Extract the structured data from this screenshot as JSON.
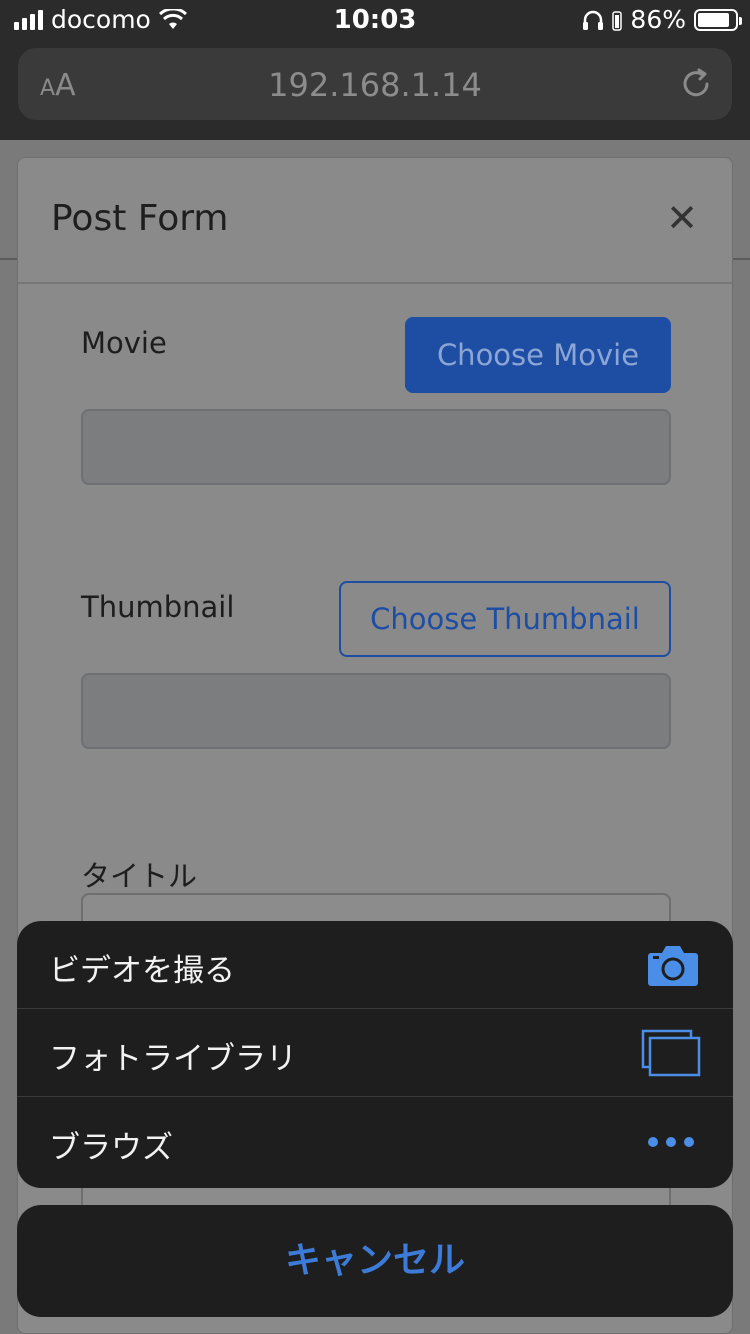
{
  "status_bar": {
    "carrier": "docomo",
    "time": "10:03",
    "battery": "86%",
    "battery_level": 0.86
  },
  "browser": {
    "text_size_label": "AA",
    "url": "192.168.1.14"
  },
  "modal": {
    "title": "Post Form",
    "close_symbol": "✕",
    "movie_label": "Movie",
    "choose_movie_label": "Choose Movie",
    "thumbnail_label": "Thumbnail",
    "choose_thumbnail_label": "Choose Thumbnail",
    "title_label": "タイトル"
  },
  "action_sheet": {
    "items": [
      {
        "label": "ビデオを撮る",
        "icon": "camera-icon"
      },
      {
        "label": "フォトライブラリ",
        "icon": "photo-library-icon"
      },
      {
        "label": "ブラウズ",
        "icon": "more-icon"
      }
    ],
    "cancel_label": "キャンセル",
    "accent_color": "#3d7bd9"
  }
}
